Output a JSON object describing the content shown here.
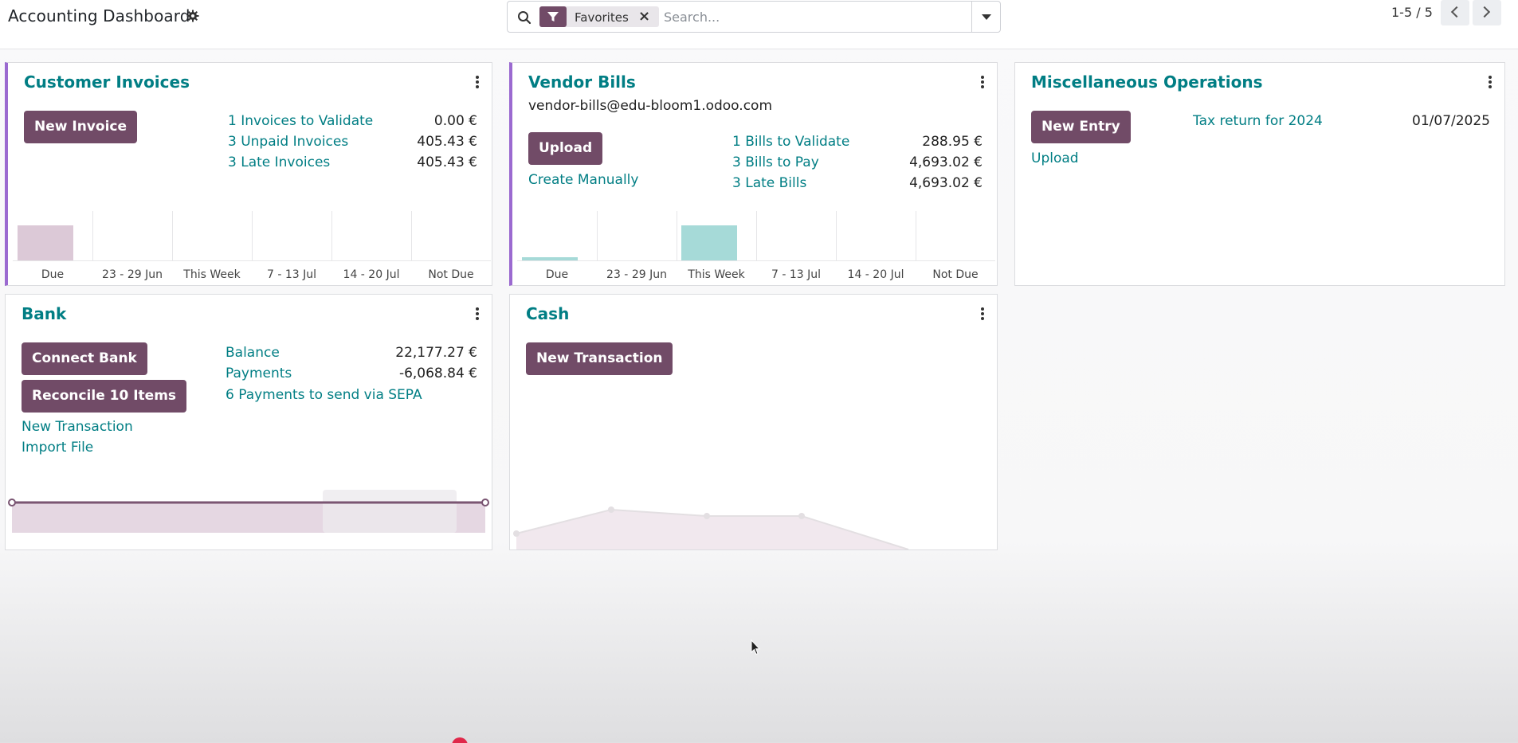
{
  "header": {
    "title": "Accounting Dashboard",
    "search": {
      "facet_label": "Favorites",
      "placeholder": "Search..."
    },
    "pager": {
      "value": "1-5 / 5"
    }
  },
  "colors": {
    "brand": "#714b67",
    "link": "#017e84",
    "accent_border": "#9b6ad0",
    "bar_sale": "#dcc9d7",
    "bar_purchase": "#a6dad8"
  },
  "cards": {
    "customer_invoices": {
      "title": "Customer Invoices",
      "button": "New Invoice",
      "stats": [
        {
          "label": "1 Invoices to Validate",
          "amount": "0.00 €"
        },
        {
          "label": "3 Unpaid Invoices",
          "amount": "405.43 €"
        },
        {
          "label": "3 Late Invoices",
          "amount": "405.43 €"
        }
      ],
      "ticks": [
        "Due",
        "23 - 29 Jun",
        "This Week",
        "7 - 13 Jul",
        "14 - 20 Jul",
        "Not Due"
      ],
      "bar_values": [
        405.43,
        0,
        0,
        0,
        0,
        0
      ]
    },
    "vendor_bills": {
      "title": "Vendor Bills",
      "email": "vendor-bills@edu-bloom1.odoo.com",
      "button": "Upload",
      "link": "Create Manually",
      "stats": [
        {
          "label": "1 Bills to Validate",
          "amount": "288.95 €"
        },
        {
          "label": "3 Bills to Pay",
          "amount": "4,693.02 €"
        },
        {
          "label": "3 Late Bills",
          "amount": "4,693.02 €"
        }
      ],
      "ticks": [
        "Due",
        "23 - 29 Jun",
        "This Week",
        "7 - 13 Jul",
        "14 - 20 Jul",
        "Not Due"
      ],
      "bar_values": [
        288.95,
        0,
        4404.07,
        0,
        0,
        0
      ]
    },
    "misc": {
      "title": "Miscellaneous Operations",
      "button": "New Entry",
      "link": "Upload",
      "item_label": "Tax return for 2024",
      "item_date": "01/07/2025"
    },
    "bank": {
      "title": "Bank",
      "button_connect": "Connect Bank",
      "button_reconcile": "Reconcile 10 Items",
      "link_new": "New Transaction",
      "link_import": "Import File",
      "balance_label": "Balance",
      "balance_amount": "22,177.27 €",
      "payments_label": "Payments",
      "payments_amount": "-6,068.84 €",
      "sepa_link": "6 Payments to send via SEPA"
    },
    "cash": {
      "title": "Cash",
      "button": "New Transaction"
    }
  }
}
